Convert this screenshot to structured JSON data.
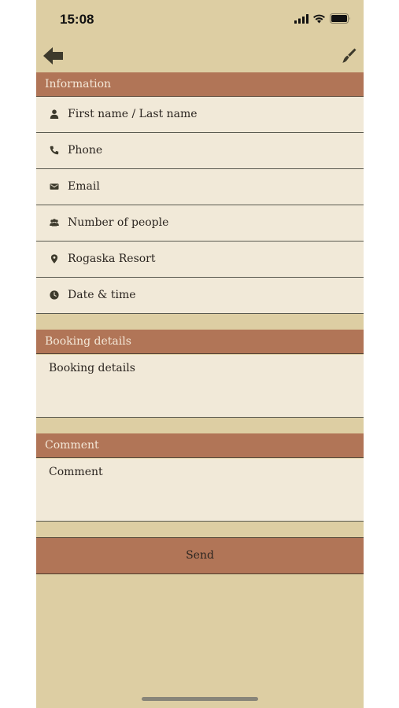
{
  "status_bar": {
    "time": "15:08",
    "icons": [
      "signal-icon",
      "wifi-icon",
      "battery-icon"
    ]
  },
  "nav": {
    "back_icon": "back-arrow-icon",
    "brush_icon": "paintbrush-icon"
  },
  "sections": {
    "information": "Information",
    "booking_details": "Booking details",
    "comment": "Comment"
  },
  "fields": [
    {
      "icon": "person-icon",
      "label": "First name / Last name"
    },
    {
      "icon": "phone-icon",
      "label": "Phone"
    },
    {
      "icon": "email-icon",
      "label": "Email"
    },
    {
      "icon": "people-icon",
      "label": "Number of people"
    },
    {
      "icon": "location-pin-icon",
      "label": "Rogaska Resort"
    },
    {
      "icon": "clock-icon",
      "label": "Date & time"
    }
  ],
  "booking_details_placeholder": "Booking details",
  "comment_placeholder": "Comment",
  "send_label": "Send",
  "colors": {
    "background": "#ddcea3",
    "header": "#b17557",
    "field": "#f1e9d8",
    "text": "#2b2520",
    "icon": "#3d3a2c"
  }
}
